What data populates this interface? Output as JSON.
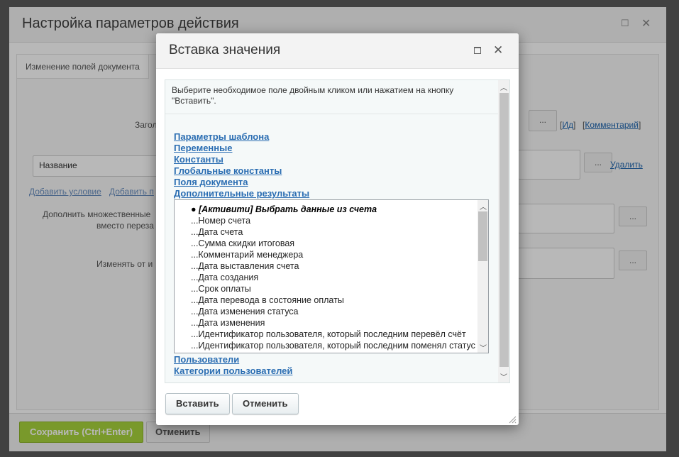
{
  "background_dialog": {
    "title": "Настройка параметров действия",
    "tab": "Изменение полей документа",
    "fields": {
      "title_label": "Загол",
      "name_select": "Название",
      "add_condition_link": "Добавить условие",
      "add_field_link": "Добавить п",
      "multiple_label_line1": "Дополнить множественные",
      "multiple_label_line2": "вместо переза",
      "change_from_label": "Изменять от и",
      "id_link": "Ид",
      "comment_link": "Комментарий",
      "delete_link": "Удалить",
      "dots": "..."
    },
    "footer": {
      "save": "Сохранить (Ctrl+Enter)",
      "cancel": "Отменить"
    }
  },
  "dialog": {
    "title": "Вставка значения",
    "instructions": "Выберите необходимое поле двойным кликом или нажатием на кнопку \"Вставить\".",
    "sections_top": [
      "Параметры шаблона",
      "Переменные",
      "Константы",
      "Глобальные константы",
      "Поля документа",
      "Дополнительные результаты"
    ],
    "list": {
      "header": "● [Активити] Выбрать данные из счета",
      "items": [
        "...Номер счета",
        "...Дата счета",
        "...Сумма скидки итоговая",
        "...Комментарий менеджера",
        "...Дата выставления счета",
        "...Дата создания",
        "...Срок оплаты",
        "...Дата перевода в состояние оплаты",
        "...Дата изменения статуса",
        "...Дата изменения",
        "...Идентификатор пользователя, который последним перевёл счёт",
        "...Идентификатор пользователя, который последним поменял статус"
      ]
    },
    "sections_bottom": [
      "Пользователи",
      "Категории пользователей"
    ],
    "buttons": {
      "insert": "Вставить",
      "cancel": "Отменить"
    }
  }
}
